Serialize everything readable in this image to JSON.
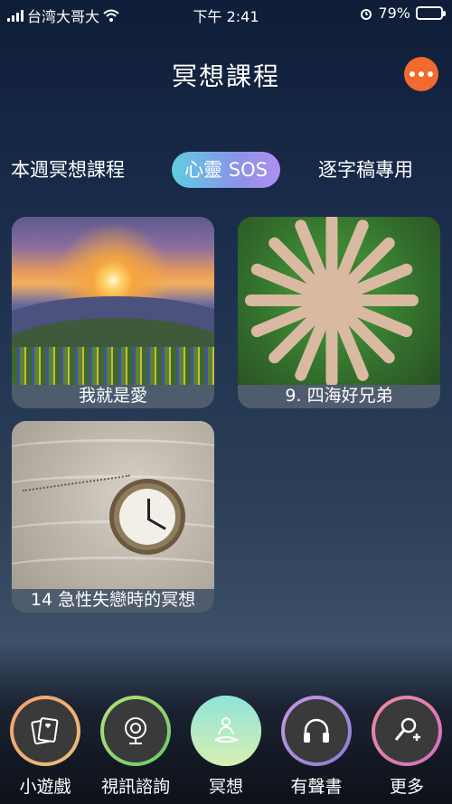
{
  "status": {
    "carrier": "台湾大哥大",
    "time": "下午 2:41",
    "battery": "79%",
    "battery_level": 0.79
  },
  "header": {
    "title": "冥想課程"
  },
  "tabs": [
    {
      "label": "本週冥想課程",
      "active": false
    },
    {
      "label": "心靈 SOS",
      "active": true
    },
    {
      "label": "逐字稿專用",
      "active": false
    }
  ],
  "cards": [
    {
      "title": "我就是愛"
    },
    {
      "title": "9. 四海好兄弟"
    },
    {
      "title": "14 急性失戀時的冥想"
    }
  ],
  "nav": [
    {
      "label": "小遊戲",
      "icon": "cards-icon"
    },
    {
      "label": "視訊諮詢",
      "icon": "webcam-icon"
    },
    {
      "label": "冥想",
      "icon": "meditation-icon",
      "active": true
    },
    {
      "label": "有聲書",
      "icon": "headphones-icon"
    },
    {
      "label": "更多",
      "icon": "add-user-icon"
    }
  ],
  "colors": {
    "accent": "#f26a2e",
    "active_tab_start": "#5fcde0",
    "active_tab_end": "#b08ff0"
  }
}
